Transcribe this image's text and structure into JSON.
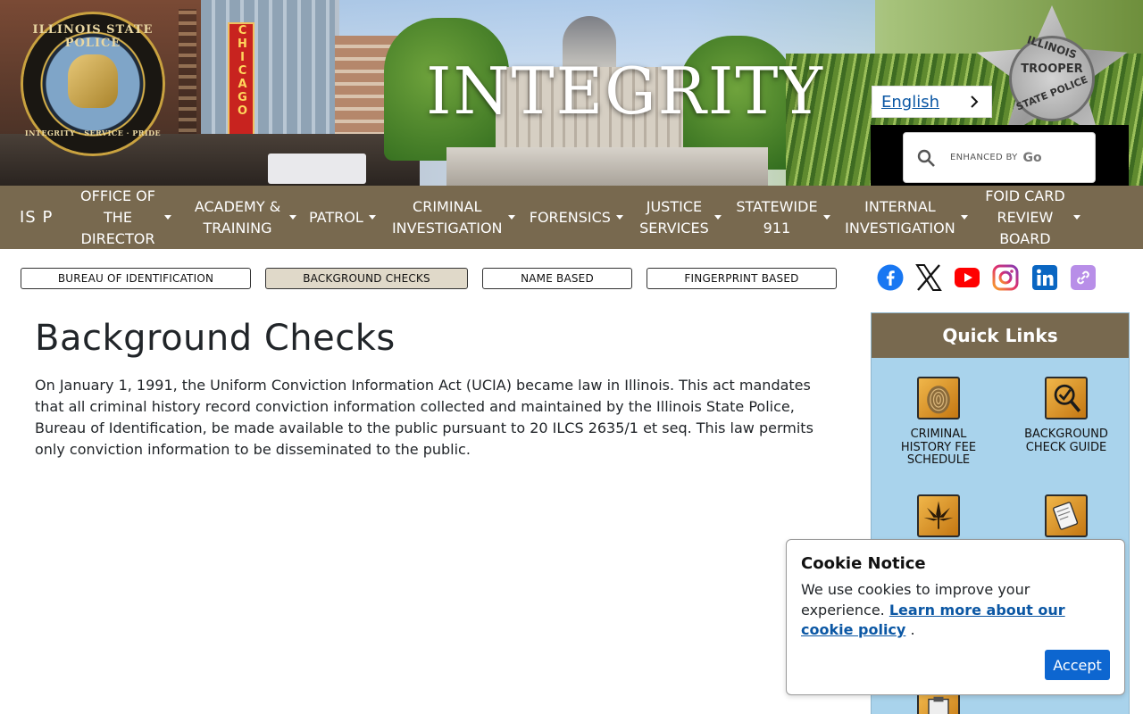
{
  "banner": {
    "seal_top_text": "ILLINOIS STATE POLICE",
    "seal_bottom_text": "INTEGRITY · SERVICE · PRIDE",
    "chicago_sign": "CHICAGO",
    "headline": "INTEGRITY",
    "badge_text": [
      "ILLINOIS",
      "TROOPER",
      "STATE POLICE"
    ],
    "language": "English",
    "search_enhanced": "ENHANCED BY",
    "search_brand": "Go"
  },
  "mainnav": {
    "items": [
      {
        "label": "IS P",
        "dropdown": false
      },
      {
        "label": "OFFICE OF THE DIRECTOR",
        "dropdown": true
      },
      {
        "label": "ACADEMY & TRAINING",
        "dropdown": true
      },
      {
        "label": "PATROL",
        "dropdown": true
      },
      {
        "label": "CRIMINAL INVESTIGATION",
        "dropdown": true
      },
      {
        "label": "FORENSICS",
        "dropdown": true
      },
      {
        "label": "JUSTICE SERVICES",
        "dropdown": true
      },
      {
        "label": "STATEWIDE 911",
        "dropdown": true
      },
      {
        "label": "INTERNAL INVESTIGATION",
        "dropdown": true
      },
      {
        "label": "FOID CARD REVIEW BOARD",
        "dropdown": true
      }
    ]
  },
  "subnav": {
    "items": [
      {
        "label": "BUREAU OF IDENTIFICATION",
        "active": false
      },
      {
        "label": "BACKGROUND CHECKS",
        "active": true
      },
      {
        "label": "NAME BASED",
        "active": false
      },
      {
        "label": "FINGERPRINT BASED",
        "active": false
      }
    ]
  },
  "social": [
    "facebook-icon",
    "x-icon",
    "youtube-icon",
    "instagram-icon",
    "linkedin-icon",
    "link-icon"
  ],
  "content": {
    "title": "Background Checks",
    "intro": "On January 1, 1991, the Uniform Conviction Information Act (UCIA) became law in Illinois. This act mandates that all criminal history record conviction information collected and maintained by the Illinois State Police, Bureau of Identification, be made available to the public pursuant to 20 ILCS 2635/1 et seq. This law permits only conviction information to be disseminated to the public."
  },
  "quick_links": {
    "title": "Quick Links",
    "items": [
      {
        "label": "CRIMINAL HISTORY FEE SCHEDULE",
        "icon": "fingerprint-icon"
      },
      {
        "label": "BACKGROUND CHECK GUIDE",
        "icon": "magnifier-check-icon"
      },
      {
        "label": "",
        "icon": "cannabis-leaf-icon"
      },
      {
        "label": "",
        "icon": "document-seal-icon"
      },
      {
        "label": "",
        "icon": "sheriff-document-icon"
      }
    ]
  },
  "cookie": {
    "title": "Cookie Notice",
    "text": "We use cookies to improve your experience.",
    "link": "Learn more about our cookie policy",
    "after_link": ".",
    "accept": "Accept"
  },
  "colors": {
    "nav_bg": "#78694f",
    "active_subnav": "#e0d9c9",
    "quick_links_bg": "#a9d3ec",
    "accept_button": "#0d66d0",
    "link": "#0b57a4"
  }
}
